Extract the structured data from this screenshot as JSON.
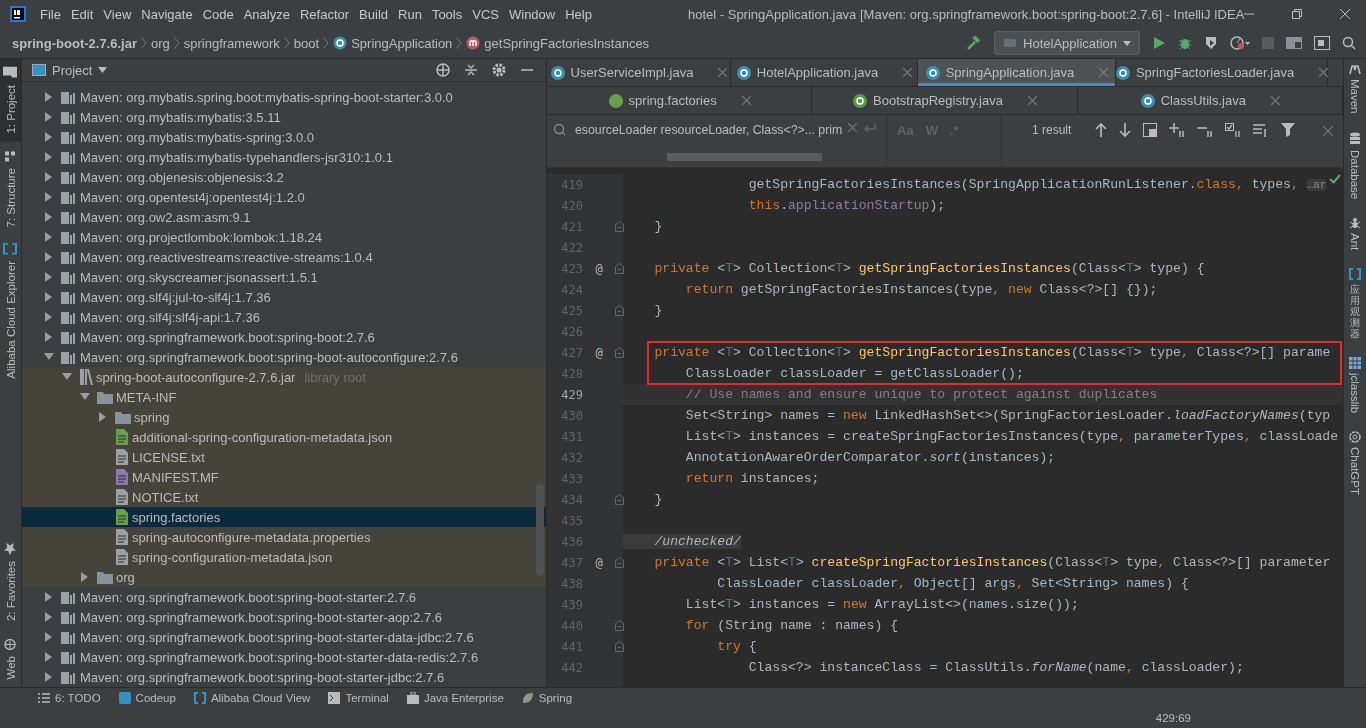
{
  "window": {
    "title": "hotel - SpringApplication.java [Maven: org.springframework.boot:spring-boot:2.7.6] - IntelliJ IDEA"
  },
  "menu": [
    "File",
    "Edit",
    "View",
    "Navigate",
    "Code",
    "Analyze",
    "Refactor",
    "Build",
    "Run",
    "Tools",
    "VCS",
    "Window",
    "Help"
  ],
  "breadcrumbs": [
    {
      "label": "spring-boot-2.7.6.jar",
      "kind": "jar"
    },
    {
      "label": "org",
      "kind": "package"
    },
    {
      "label": "springframework",
      "kind": "package"
    },
    {
      "label": "boot",
      "kind": "package"
    },
    {
      "label": "SpringApplication",
      "kind": "class"
    },
    {
      "label": "getSpringFactoriesInstances",
      "kind": "method"
    }
  ],
  "run_config": "HotelApplication",
  "left_strip": {
    "top": [
      {
        "label": "1: Project",
        "selected": true,
        "kind": "folder"
      },
      {
        "label": "7: Structure",
        "selected": false,
        "kind": "structure"
      },
      {
        "label": "Alibaba Cloud Explorer",
        "selected": false,
        "kind": "cloud"
      }
    ],
    "bottom": [
      {
        "label": "2: Favorites",
        "selected": false,
        "kind": "star"
      },
      {
        "label": "Web",
        "selected": false,
        "kind": "globe"
      }
    ]
  },
  "project": {
    "title": "Project",
    "tree": [
      {
        "label": "Maven: org.mybatis.spring.boot:mybatis-spring-boot-starter:3.0.0",
        "kind": "lib",
        "expanded": false,
        "selected": false
      },
      {
        "label": "Maven: org.mybatis:mybatis:3.5.11",
        "kind": "lib",
        "expanded": false,
        "selected": false
      },
      {
        "label": "Maven: org.mybatis:mybatis-spring:3.0.0",
        "kind": "lib",
        "expanded": false,
        "selected": false
      },
      {
        "label": "Maven: org.mybatis:mybatis-typehandlers-jsr310:1.0.1",
        "kind": "lib",
        "expanded": false,
        "selected": false
      },
      {
        "label": "Maven: org.objenesis:objenesis:3.2",
        "kind": "lib",
        "expanded": false,
        "selected": false
      },
      {
        "label": "Maven: org.opentest4j:opentest4j:1.2.0",
        "kind": "lib",
        "expanded": false,
        "selected": false
      },
      {
        "label": "Maven: org.ow2.asm:asm:9.1",
        "kind": "lib",
        "expanded": false,
        "selected": false
      },
      {
        "label": "Maven: org.projectlombok:lombok:1.18.24",
        "kind": "lib",
        "expanded": false,
        "selected": false
      },
      {
        "label": "Maven: org.reactivestreams:reactive-streams:1.0.4",
        "kind": "lib",
        "expanded": false,
        "selected": false
      },
      {
        "label": "Maven: org.skyscreamer:jsonassert:1.5.1",
        "kind": "lib",
        "expanded": false,
        "selected": false
      },
      {
        "label": "Maven: org.slf4j:jul-to-slf4j:1.7.36",
        "kind": "lib",
        "expanded": false,
        "selected": false
      },
      {
        "label": "Maven: org.slf4j:slf4j-api:1.7.36",
        "kind": "lib",
        "expanded": false,
        "selected": false
      },
      {
        "label": "Maven: org.springframework.boot:spring-boot:2.7.6",
        "kind": "lib",
        "expanded": false,
        "selected": false
      },
      {
        "label": "Maven: org.springframework.boot:spring-boot-autoconfigure:2.7.6",
        "kind": "lib",
        "expanded": true,
        "selected": false,
        "children": [
          {
            "label": "spring-boot-autoconfigure-2.7.6.jar",
            "note": "library root",
            "kind": "jar",
            "expanded": true,
            "selected": false,
            "children": [
              {
                "label": "META-INF",
                "kind": "folder",
                "expanded": true,
                "selected": false,
                "children": [
                  {
                    "label": "spring",
                    "kind": "folder",
                    "expanded": false,
                    "selected": false
                  },
                  {
                    "label": "additional-spring-configuration-metadata.json",
                    "kind": "springjson",
                    "selected": false
                  },
                  {
                    "label": "LICENSE.txt",
                    "kind": "text",
                    "selected": false
                  },
                  {
                    "label": "MANIFEST.MF",
                    "kind": "manifest",
                    "selected": false
                  },
                  {
                    "label": "NOTICE.txt",
                    "kind": "text",
                    "selected": false
                  },
                  {
                    "label": "spring.factories",
                    "kind": "spring",
                    "selected": true
                  },
                  {
                    "label": "spring-autoconfigure-metadata.properties",
                    "kind": "properties",
                    "selected": false
                  },
                  {
                    "label": "spring-configuration-metadata.json",
                    "kind": "json",
                    "selected": false
                  }
                ]
              },
              {
                "label": "org",
                "kind": "folder",
                "expanded": false,
                "selected": false
              }
            ]
          }
        ]
      },
      {
        "label": "Maven: org.springframework.boot:spring-boot-starter:2.7.6",
        "kind": "lib",
        "expanded": false,
        "selected": false
      },
      {
        "label": "Maven: org.springframework.boot:spring-boot-starter-aop:2.7.6",
        "kind": "lib",
        "expanded": false,
        "selected": false
      },
      {
        "label": "Maven: org.springframework.boot:spring-boot-starter-data-jdbc:2.7.6",
        "kind": "lib",
        "expanded": false,
        "selected": false
      },
      {
        "label": "Maven: org.springframework.boot:spring-boot-starter-data-redis:2.7.6",
        "kind": "lib",
        "expanded": false,
        "selected": false
      },
      {
        "label": "Maven: org.springframework.boot:spring-boot-starter-jdbc:2.7.6",
        "kind": "lib",
        "expanded": false,
        "selected": false
      }
    ]
  },
  "editor_tabs": [
    [
      {
        "label": "UserServiceImpl.java",
        "kind": "class",
        "selected": false
      },
      {
        "label": "HotelApplication.java",
        "kind": "app",
        "selected": false
      },
      {
        "label": "SpringApplication.java",
        "kind": "lockedclass",
        "selected": true
      },
      {
        "label": "SpringFactoriesLoader.java",
        "kind": "lockedclass",
        "selected": false
      }
    ],
    [
      {
        "label": "spring.factories",
        "kind": "spring",
        "selected": false
      },
      {
        "label": "BootstrapRegistry.java",
        "kind": "interface",
        "selected": false
      },
      {
        "label": "ClassUtils.java",
        "kind": "lockedclass",
        "selected": false
      }
    ]
  ],
  "search": {
    "value": "esourceLoader resourceLoader, Class<?>... prim",
    "options": [
      "Aa",
      "W",
      ".*"
    ],
    "result": "1 result"
  },
  "code": [
    {
      "number": "419",
      "tokens": [
        {
          "text": "                getSpringFactoriesInstances(SpringApplicationRunListener.",
          "kind": "plain"
        },
        {
          "text": "class",
          "kind": "keyword"
        },
        {
          "text": ", ",
          "kind": "keyword"
        },
        {
          "text": "types",
          "kind": "plain"
        },
        {
          "text": ", ",
          "kind": "keyword"
        },
        {
          "text": "…ar",
          "kind": "hint"
        }
      ]
    },
    {
      "number": "420",
      "tokens": [
        {
          "text": "                this",
          "kind": "keyword"
        },
        {
          "text": ".",
          "kind": "plain"
        },
        {
          "text": "applicationStartup",
          "kind": "field"
        },
        {
          "text": ");",
          "kind": "plain"
        }
      ]
    },
    {
      "number": "421",
      "fold": true,
      "tokens": [
        {
          "text": "    }",
          "kind": "plain"
        }
      ]
    },
    {
      "number": "422"
    },
    {
      "number": "423",
      "mark": "@",
      "fold": true,
      "tokens": [
        {
          "text": "    private",
          "kind": "keyword"
        },
        {
          "text": " <",
          "kind": "plain"
        },
        {
          "text": "T",
          "kind": "generic"
        },
        {
          "text": "> Collection<",
          "kind": "plain"
        },
        {
          "text": "T",
          "kind": "generic"
        },
        {
          "text": "> ",
          "kind": "plain"
        },
        {
          "text": "getSpringFactoriesInstances",
          "kind": "function"
        },
        {
          "text": "(Class<",
          "kind": "plain"
        },
        {
          "text": "T",
          "kind": "generic"
        },
        {
          "text": "> type) {",
          "kind": "plain"
        }
      ]
    },
    {
      "number": "424",
      "tokens": [
        {
          "text": "        return",
          "kind": "keyword"
        },
        {
          "text": " getSpringFactoriesInstances(type",
          "kind": "plain"
        },
        {
          "text": ", ",
          "kind": "keyword"
        },
        {
          "text": "new",
          "kind": "keyword"
        },
        {
          "text": " Class<?>[] {});",
          "kind": "plain"
        }
      ]
    },
    {
      "number": "425",
      "fold": true,
      "tokens": [
        {
          "text": "    }",
          "kind": "plain"
        }
      ]
    },
    {
      "number": "426"
    },
    {
      "number": "427",
      "mark": "@",
      "fold": true,
      "boxed": true,
      "tokens": [
        {
          "text": "    private",
          "kind": "keyword"
        },
        {
          "text": " <",
          "kind": "plain"
        },
        {
          "text": "T",
          "kind": "generic"
        },
        {
          "text": "> Collection<",
          "kind": "plain"
        },
        {
          "text": "T",
          "kind": "generic"
        },
        {
          "text": "> ",
          "kind": "plain"
        },
        {
          "text": "getSpringFactoriesInstances",
          "kind": "function"
        },
        {
          "text": "(Class<",
          "kind": "plain"
        },
        {
          "text": "T",
          "kind": "generic"
        },
        {
          "text": "> type",
          "kind": "plain"
        },
        {
          "text": ", ",
          "kind": "keyword"
        },
        {
          "text": "Class<?>[] parame",
          "kind": "plain"
        }
      ]
    },
    {
      "number": "428",
      "boxed": true,
      "tokens": [
        {
          "text": "        ClassLoader classLoader = getClassLoader();",
          "kind": "plain"
        }
      ]
    },
    {
      "number": "429",
      "current": true,
      "tokens": [
        {
          "text": "        // Use names and ensure unique to protect against duplicates",
          "kind": "comment"
        }
      ]
    },
    {
      "number": "430",
      "tokens": [
        {
          "text": "        Set<String> names = ",
          "kind": "plain"
        },
        {
          "text": "new",
          "kind": "keyword"
        },
        {
          "text": " LinkedHashSet<>(SpringFactoriesLoader.",
          "kind": "plain"
        },
        {
          "text": "loadFactoryNames",
          "kind": "static"
        },
        {
          "text": "(typ",
          "kind": "plain"
        }
      ]
    },
    {
      "number": "431",
      "tokens": [
        {
          "text": "        List<",
          "kind": "plain"
        },
        {
          "text": "T",
          "kind": "generic"
        },
        {
          "text": "> instances = createSpringFactoriesInstances(type",
          "kind": "plain"
        },
        {
          "text": ", ",
          "kind": "keyword"
        },
        {
          "text": "parameterTypes",
          "kind": "plain"
        },
        {
          "text": ", ",
          "kind": "keyword"
        },
        {
          "text": "classLoade",
          "kind": "plain"
        }
      ]
    },
    {
      "number": "432",
      "tokens": [
        {
          "text": "        AnnotationAwareOrderComparator.",
          "kind": "plain"
        },
        {
          "text": "sort",
          "kind": "static"
        },
        {
          "text": "(instances);",
          "kind": "plain"
        }
      ]
    },
    {
      "number": "433",
      "tokens": [
        {
          "text": "        return",
          "kind": "keyword"
        },
        {
          "text": " instances;",
          "kind": "plain"
        }
      ]
    },
    {
      "number": "434",
      "fold": true,
      "tokens": [
        {
          "text": "    }",
          "kind": "plain"
        }
      ]
    },
    {
      "number": "435"
    },
    {
      "number": "436",
      "tokens": [
        {
          "text": "    /unchecked/",
          "kind": "doc"
        }
      ]
    },
    {
      "number": "437",
      "mark": "@",
      "fold": true,
      "tokens": [
        {
          "text": "    private",
          "kind": "keyword"
        },
        {
          "text": " <",
          "kind": "plain"
        },
        {
          "text": "T",
          "kind": "generic"
        },
        {
          "text": "> List<",
          "kind": "plain"
        },
        {
          "text": "T",
          "kind": "generic"
        },
        {
          "text": "> ",
          "kind": "plain"
        },
        {
          "text": "createSpringFactoriesInstances",
          "kind": "function"
        },
        {
          "text": "(Class<",
          "kind": "plain"
        },
        {
          "text": "T",
          "kind": "generic"
        },
        {
          "text": "> type",
          "kind": "plain"
        },
        {
          "text": ", ",
          "kind": "keyword"
        },
        {
          "text": "Class<?>[] parameter",
          "kind": "plain"
        }
      ]
    },
    {
      "number": "438",
      "tokens": [
        {
          "text": "            ClassLoader classLoader",
          "kind": "plain"
        },
        {
          "text": ", ",
          "kind": "keyword"
        },
        {
          "text": "Object[] args",
          "kind": "plain"
        },
        {
          "text": ", ",
          "kind": "keyword"
        },
        {
          "text": "Set<String> names) {",
          "kind": "plain"
        }
      ]
    },
    {
      "number": "439",
      "tokens": [
        {
          "text": "        List<",
          "kind": "plain"
        },
        {
          "text": "T",
          "kind": "generic"
        },
        {
          "text": "> instances = ",
          "kind": "plain"
        },
        {
          "text": "new",
          "kind": "keyword"
        },
        {
          "text": " ArrayList<>(names.size());",
          "kind": "plain"
        }
      ]
    },
    {
      "number": "440",
      "fold": true,
      "tokens": [
        {
          "text": "        for",
          "kind": "keyword"
        },
        {
          "text": " (String name : names) {",
          "kind": "plain"
        }
      ]
    },
    {
      "number": "441",
      "fold": true,
      "tokens": [
        {
          "text": "            try",
          "kind": "keyword"
        },
        {
          "text": " {",
          "kind": "plain"
        }
      ]
    },
    {
      "number": "442",
      "tokens": [
        {
          "text": "                Class<?> instanceClass = ClassUtils.",
          "kind": "plain"
        },
        {
          "text": "forName",
          "kind": "static"
        },
        {
          "text": "(name",
          "kind": "plain"
        },
        {
          "text": ", ",
          "kind": "keyword"
        },
        {
          "text": "classLoader);",
          "kind": "plain"
        }
      ]
    }
  ],
  "right_strip": [
    {
      "label": "Maven",
      "kind": "maven"
    },
    {
      "label": "Database",
      "kind": "database"
    },
    {
      "label": "Ant",
      "kind": "ant"
    },
    {
      "label": "应用观测器",
      "kind": "observe",
      "cjk": true
    },
    {
      "label": "jclasslib",
      "kind": "jclasslib"
    },
    {
      "label": "ChatGPT",
      "kind": "chatgpt"
    }
  ],
  "tool_windows": [
    {
      "label": "6: TODO",
      "kind": "list"
    },
    {
      "label": "Codeup",
      "kind": "codeup"
    },
    {
      "label": "Alibaba Cloud View",
      "kind": "cloud"
    },
    {
      "label": "Terminal",
      "kind": "terminal"
    },
    {
      "label": "Java Enterprise",
      "kind": "enterprise"
    },
    {
      "label": "Spring",
      "kind": "spring"
    }
  ],
  "status_bar": {
    "position": "429:69"
  }
}
